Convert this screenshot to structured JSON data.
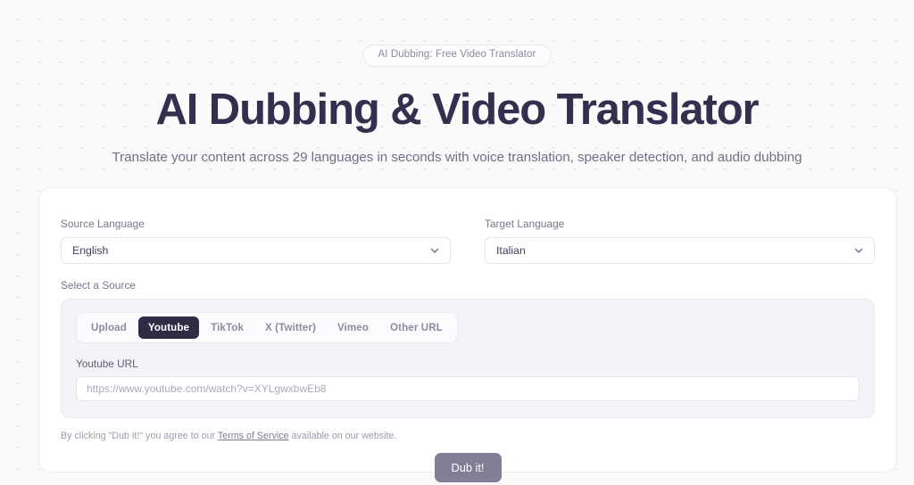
{
  "hero": {
    "badge": "AI Dubbing: Free Video Translator",
    "title": "AI Dubbing & Video Translator",
    "subtitle": "Translate your content across 29 languages in seconds with voice translation, speaker detection, and audio dubbing"
  },
  "form": {
    "source_language": {
      "label": "Source Language",
      "value": "English"
    },
    "target_language": {
      "label": "Target Language",
      "value": "Italian"
    },
    "select_source_label": "Select a Source",
    "tabs": [
      {
        "label": "Upload",
        "active": false
      },
      {
        "label": "Youtube",
        "active": true
      },
      {
        "label": "TikTok",
        "active": false
      },
      {
        "label": "X (Twitter)",
        "active": false
      },
      {
        "label": "Vimeo",
        "active": false
      },
      {
        "label": "Other URL",
        "active": false
      }
    ],
    "url_field": {
      "label": "Youtube URL",
      "value": "",
      "placeholder": "https://www.youtube.com/watch?v=XYLgwxbwEb8"
    }
  },
  "footer": {
    "terms_prefix": "By clicking \"Dub it!\" you agree to our ",
    "terms_link": "Terms of Service",
    "terms_suffix": " available on our website.",
    "cta_label": "Dub it!"
  },
  "colors": {
    "page_background": "#fafafb",
    "dot_grid": "#e4e4ea",
    "heading": "#332f4e",
    "active_tab": "#2e2b45",
    "cta_background": "#817f96",
    "panel_background": "#f4f4f8"
  },
  "icons": {
    "chevron_down": "chevron-down-icon"
  }
}
